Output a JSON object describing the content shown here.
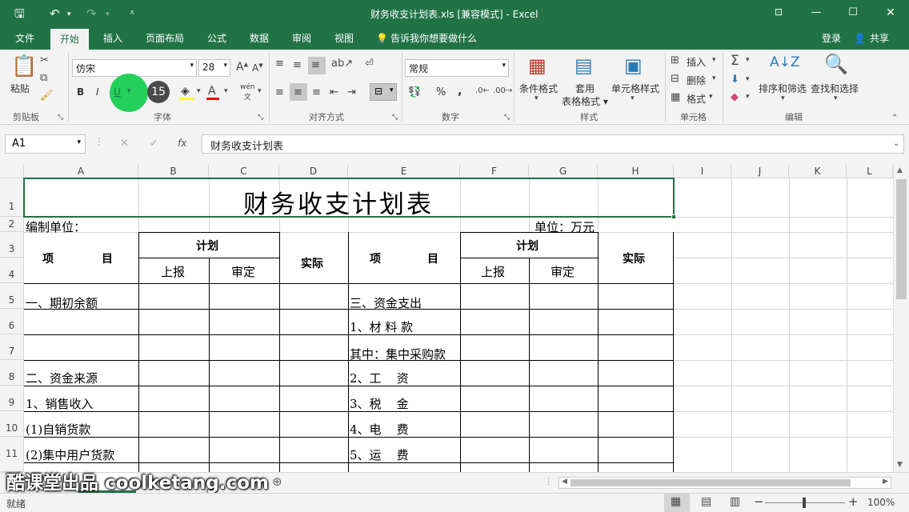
{
  "title_bar": {
    "document_title": "财务收支计划表.xls  [兼容模式] - Excel"
  },
  "tabs": [
    "文件",
    "开始",
    "插入",
    "页面布局",
    "公式",
    "数据",
    "审阅",
    "视图"
  ],
  "tell_me": "告诉我你想要做什么",
  "account": {
    "login": "登录",
    "share": "共享"
  },
  "ribbon": {
    "clipboard": {
      "paste": "粘贴",
      "label": "剪贴板"
    },
    "font": {
      "name": "仿宋",
      "size": "28",
      "label": "字体",
      "bold": "B",
      "italic": "I",
      "underline": "U",
      "wen": "wén"
    },
    "alignment": {
      "label": "对齐方式"
    },
    "number": {
      "format": "常规",
      "label": "数字",
      "percent": "%",
      "comma": ","
    },
    "styles": {
      "conditional": "条件格式",
      "table_format": "套用\n表格格式",
      "cell_styles": "单元格样式",
      "label": "样式"
    },
    "cells": {
      "insert": "插入",
      "delete": "删除",
      "format": "格式",
      "label": "单元格"
    },
    "editing": {
      "sort_filter": "排序和筛选",
      "find_select": "查找和选择",
      "label": "编辑"
    }
  },
  "click_badge": "15",
  "formula_bar": {
    "name_box": "A1",
    "fx": "fx",
    "content": "财务收支计划表"
  },
  "columns": [
    "A",
    "B",
    "C",
    "D",
    "E",
    "F",
    "G",
    "H",
    "I",
    "J",
    "K",
    "L"
  ],
  "rows": [
    "1",
    "2",
    "3",
    "4",
    "5",
    "6",
    "7",
    "8",
    "9",
    "10",
    "11"
  ],
  "sheet": {
    "title": "财务收支计划表",
    "unit_label": "编制单位：",
    "unit_value": "单位：万元",
    "plan": "计划",
    "reported": "上报",
    "approved": "审定",
    "actual": "实际",
    "item": "项",
    "item2": "目",
    "left_items": [
      "一、期初余额",
      "",
      "",
      "二、资金来源",
      "1、销售收入",
      "(1)自销货款",
      "(2)集中用户货款"
    ],
    "right_items": [
      "三、资金支出",
      "1、材 料 款",
      "其中：集中采购款",
      "2、工    资",
      "3、税    金",
      "4、电    费",
      "5、运    费"
    ]
  },
  "watermark": "酷课堂出品 coolketang.com",
  "status": {
    "ready": "就绪",
    "zoom": "100%"
  }
}
